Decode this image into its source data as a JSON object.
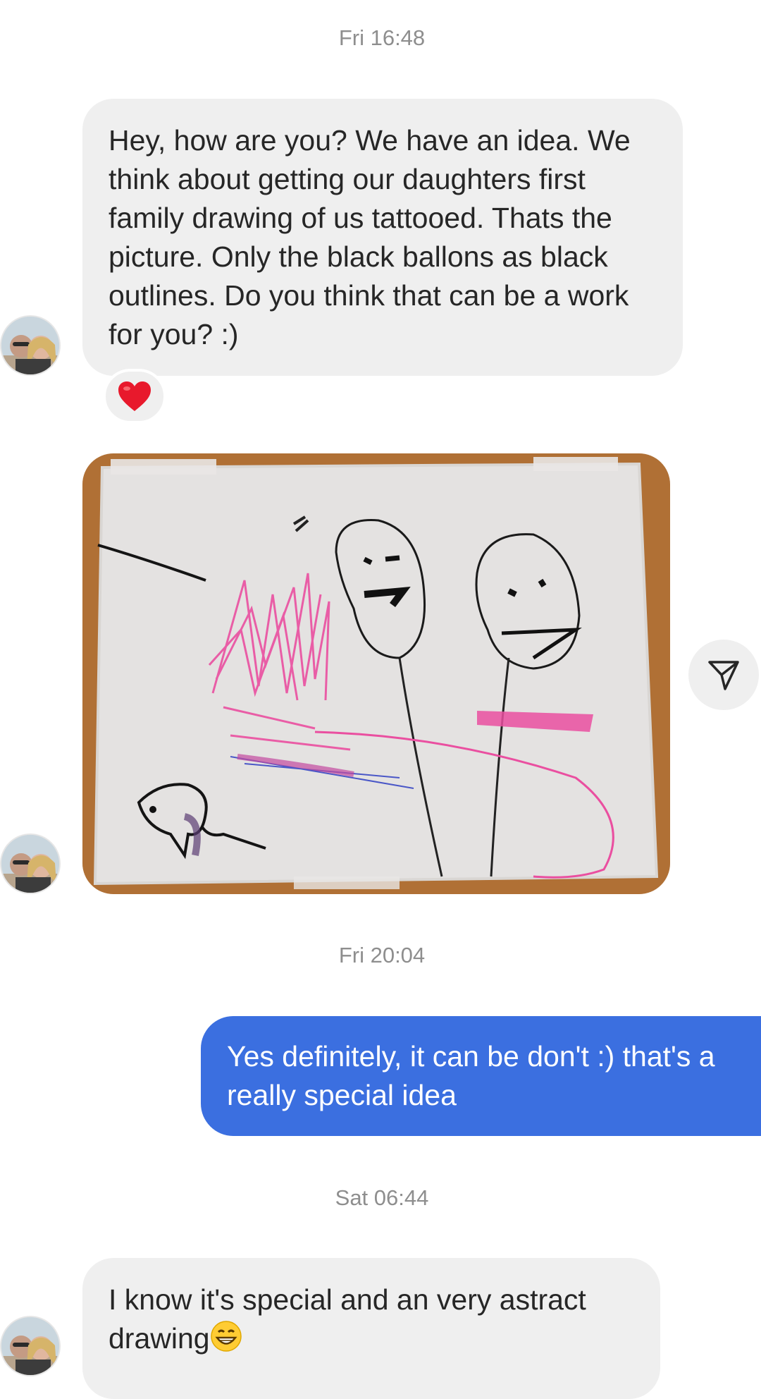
{
  "timestamps": {
    "first": "Fri 16:48",
    "second": "Fri 20:04",
    "third": "Sat 06:44"
  },
  "messages": {
    "incoming_1": "Hey, how are you? We have an idea. We think about getting our daughters first family drawing of us tattooed. Thats the picture. Only the black ballons as black outlines. Do you think that can be a work for you? :)",
    "incoming_1_reaction": "heart",
    "incoming_2_image": "child-family-drawing-photo",
    "outgoing_1": "Yes definitely, it can be don't :) that's a really special idea",
    "incoming_3": "I know it's special and an very astract drawing"
  },
  "icons": {
    "share": "paper-plane-icon",
    "reaction": "heart-icon",
    "emoji": "grinning-face-icon"
  },
  "colors": {
    "incoming_bubble": "#efefef",
    "outgoing_bubble": "#3b6fe0",
    "timestamp": "#8e8e8e",
    "reaction_heart": "#e8192c"
  }
}
